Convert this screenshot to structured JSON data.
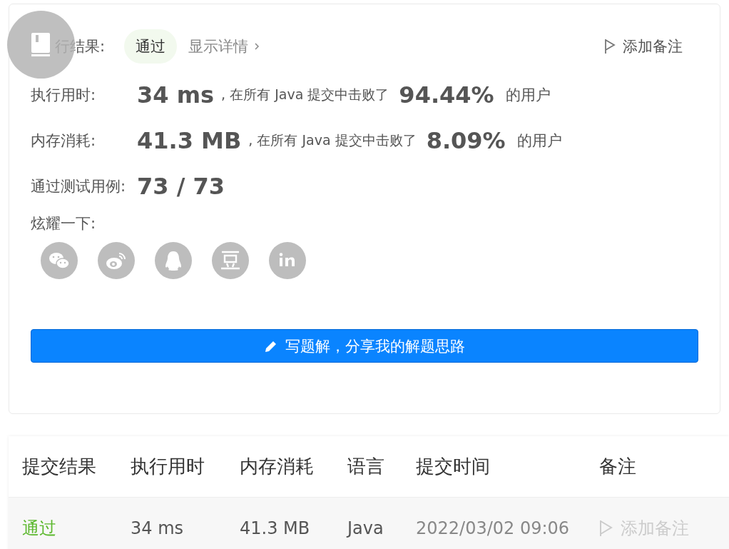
{
  "result": {
    "label": "行结果:",
    "status": "通过",
    "details_link": "显示详情",
    "note_button": "添加备注"
  },
  "stats": [
    {
      "label": "执行用时:",
      "value": "34 ms",
      "text": ", 在所有 Java 提交中击败了",
      "percent": "94.44%",
      "suffix": "的用户"
    },
    {
      "label": "内存消耗:",
      "value": "41.3 MB",
      "text": ", 在所有 Java 提交中击败了",
      "percent": "8.09%",
      "suffix": "的用户"
    }
  ],
  "cases": {
    "label": "通过测试用例:",
    "value": "73 / 73"
  },
  "share": {
    "label": "炫耀一下:",
    "icons": [
      {
        "kind": "wechat"
      },
      {
        "kind": "weibo"
      },
      {
        "kind": "qq"
      },
      {
        "kind": "douban"
      },
      {
        "kind": "linkedin"
      }
    ]
  },
  "solution_button": "写题解，分享我的解题思路",
  "table": {
    "columns": [
      "提交结果",
      "执行用时",
      "内存消耗",
      "语言",
      "提交时间",
      "备注"
    ],
    "rows": [
      {
        "status": "通过",
        "time": "34 ms",
        "memory": "41.3 MB",
        "language": "Java",
        "submitted": "2022/03/02 09:06",
        "note": "添加备注"
      }
    ]
  }
}
